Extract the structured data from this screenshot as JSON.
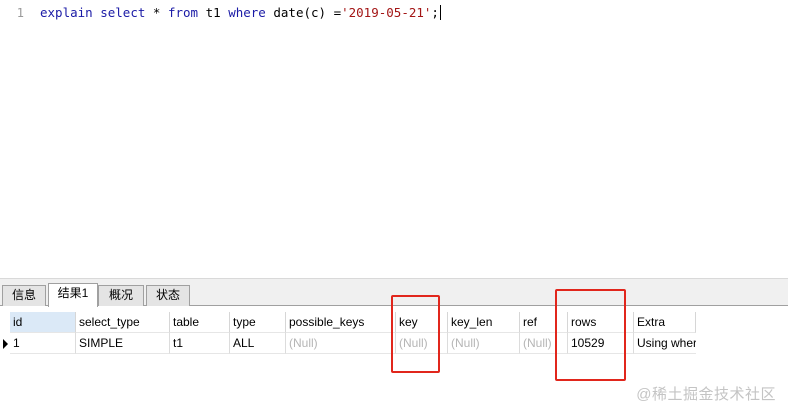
{
  "editor": {
    "line_number": "1",
    "tokens": {
      "kw_explain": "explain",
      "kw_select": "select",
      "star": "*",
      "kw_from": "from",
      "table": "t1",
      "kw_where": "where",
      "func": "date(c) =",
      "literal": "'2019-05-21'",
      "terminator": ";"
    }
  },
  "result_tabs": [
    {
      "label": "信息",
      "active": false
    },
    {
      "label": "结果1",
      "active": true
    },
    {
      "label": "概况",
      "active": false
    },
    {
      "label": "状态",
      "active": false
    }
  ],
  "grid": {
    "columns": [
      "id",
      "select_type",
      "table",
      "type",
      "possible_keys",
      "key",
      "key_len",
      "ref",
      "rows",
      "Extra"
    ],
    "rows": [
      [
        "1",
        "SIMPLE",
        "t1",
        "ALL",
        "(Null)",
        "(Null)",
        "(Null)",
        "(Null)",
        "10529",
        "Using where"
      ]
    ]
  },
  "colors": {
    "keyword": "#1a1aa6",
    "string_literal": "#a31515",
    "highlight_box": "#e1261c",
    "null_text": "#b5b5b5"
  },
  "watermark": "@稀土掘金技术社区"
}
